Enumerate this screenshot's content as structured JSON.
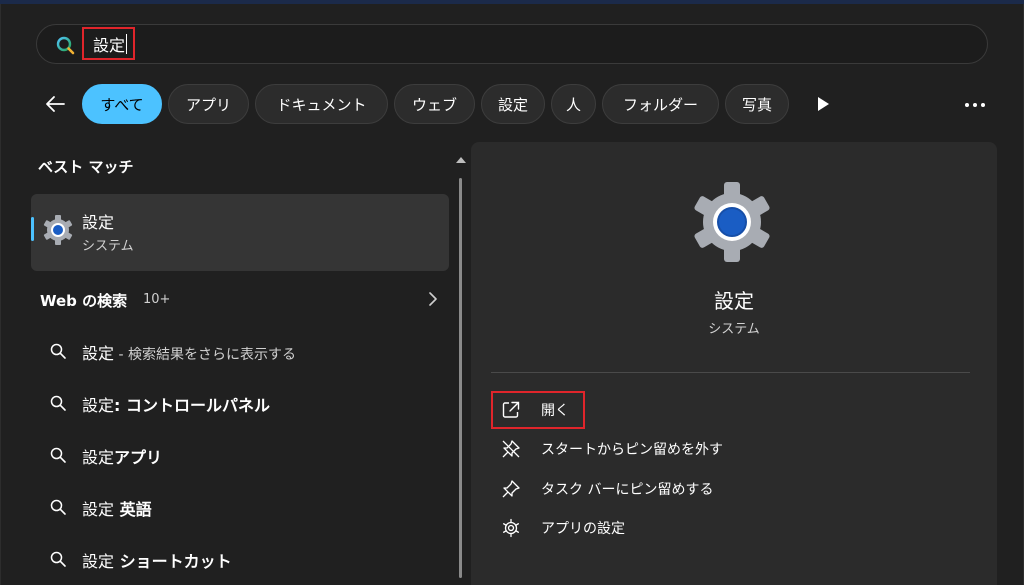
{
  "search": {
    "query": "設定"
  },
  "filters": {
    "chips": [
      {
        "label": "すべて",
        "active": true
      },
      {
        "label": "アプリ"
      },
      {
        "label": "ドキュメント"
      },
      {
        "label": "ウェブ"
      },
      {
        "label": "設定"
      },
      {
        "label": "人"
      },
      {
        "label": "フォルダー"
      },
      {
        "label": "写真"
      }
    ],
    "icons": {
      "back": "back-arrow-icon",
      "play": "play-icon",
      "more": "more-options-icon"
    }
  },
  "left": {
    "best_match_title": "ベスト マッチ",
    "best_match": {
      "title": "設定",
      "subtitle": "システム",
      "icon": "settings-gear-icon"
    },
    "web_header": "Web の検索",
    "web_count": "10+",
    "results": [
      {
        "main": "設定",
        "suffix": " - 検索結果をさらに表示する",
        "bold": ""
      },
      {
        "main": "設定",
        "suffix": "",
        "bold": ": コントロールパネル"
      },
      {
        "main": "設定",
        "suffix": "",
        "bold": "アプリ"
      },
      {
        "main": "設定",
        "suffix": "",
        "bold": " 英語"
      },
      {
        "main": "設定",
        "suffix": "",
        "bold": " ショートカット"
      }
    ]
  },
  "detail": {
    "title": "設定",
    "subtitle": "システム",
    "actions": [
      {
        "label": "開く",
        "icon": "open-external-icon"
      },
      {
        "label": "スタートからピン留めを外す",
        "icon": "unpin-icon"
      },
      {
        "label": "タスク バーにピン留めする",
        "icon": "pin-icon"
      },
      {
        "label": "アプリの設定",
        "icon": "gear-outline-icon"
      }
    ]
  },
  "colors": {
    "accent": "#4cc2ff",
    "highlight_box": "#e0252b",
    "pane_bg": "#2b2b2b",
    "window_bg": "#202020"
  }
}
